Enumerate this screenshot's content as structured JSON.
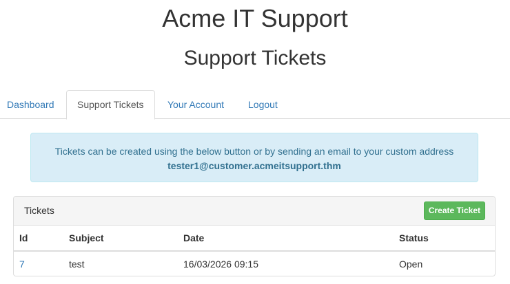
{
  "site": {
    "title": "Acme IT Support"
  },
  "page": {
    "title": "Support Tickets"
  },
  "nav": {
    "tabs": [
      {
        "label": "Dashboard"
      },
      {
        "label": "Support Tickets",
        "active": true
      },
      {
        "label": "Your Account"
      },
      {
        "label": "Logout"
      }
    ]
  },
  "alert": {
    "message": "Tickets can be created using the below button or by sending an email to your custom address",
    "email": "tester1@customer.acmeitsupport.thm"
  },
  "tickets_panel": {
    "title": "Tickets",
    "create_button_label": "Create Ticket",
    "columns": [
      "Id",
      "Subject",
      "Date",
      "Status"
    ],
    "rows": [
      {
        "id": "7",
        "subject": "test",
        "date": "16/03/2026 09:15",
        "status": "Open"
      }
    ]
  },
  "colors": {
    "link": "#337ab7",
    "alert_bg": "#d9edf7",
    "alert_text": "#31708f",
    "success_button": "#5cb85c"
  }
}
